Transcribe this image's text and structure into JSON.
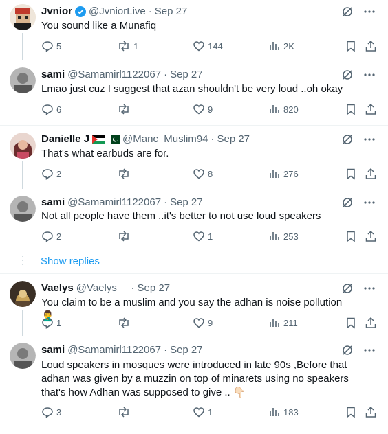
{
  "tweets": [
    {
      "name": "Jvnior",
      "handle": "@JvniorLive",
      "date": "Sep 27",
      "verified": true,
      "flags": "",
      "text": "You sound like a Munafiq",
      "replies": "5",
      "retweets": "1",
      "likes": "144",
      "views": "2K"
    },
    {
      "name": "sami",
      "handle": "@Samamirl1122067",
      "date": "Sep 27",
      "verified": false,
      "flags": "",
      "text": "Lmao just cuz I suggest that azan shouldn't be very loud ..oh okay",
      "replies": "6",
      "retweets": "",
      "likes": "9",
      "views": "820"
    },
    {
      "name": "Danielle J",
      "handle": "@Manc_Muslim94",
      "date": "Sep 27",
      "verified": false,
      "flags": "🇵🇸 🇵🇰",
      "text": "That's what earbuds are for.",
      "replies": "2",
      "retweets": "",
      "likes": "8",
      "views": "276"
    },
    {
      "name": "sami",
      "handle": "@Samamirl1122067",
      "date": "Sep 27",
      "verified": false,
      "flags": "",
      "text": "Not all people have them ..it's better to not use loud speakers",
      "replies": "2",
      "retweets": "",
      "likes": "1",
      "views": "253"
    },
    {
      "name": "Vaelys",
      "handle": "@Vaelys__",
      "date": "Sep 27",
      "verified": false,
      "flags": "",
      "text": "You claim to be a muslim and you say the adhan is noise pollution 🤦‍♂️",
      "replies": "1",
      "retweets": "",
      "likes": "9",
      "views": "211"
    },
    {
      "name": "sami",
      "handle": "@Samamirl1122067",
      "date": "Sep 27",
      "verified": false,
      "flags": "",
      "text": "Loud speakers in mosques were introduced in late 90s ,Before that adhan was given by a muzzin on top of minarets using no speakers that's how Adhan was supposed to give .. 👇🏻",
      "replies": "3",
      "retweets": "",
      "likes": "1",
      "views": "183"
    }
  ],
  "dot": "·",
  "show_replies": "Show replies",
  "colors": {
    "accent": "#1d9bf0",
    "text": "#0f1419",
    "muted": "#536471",
    "line": "#cfd9de"
  }
}
